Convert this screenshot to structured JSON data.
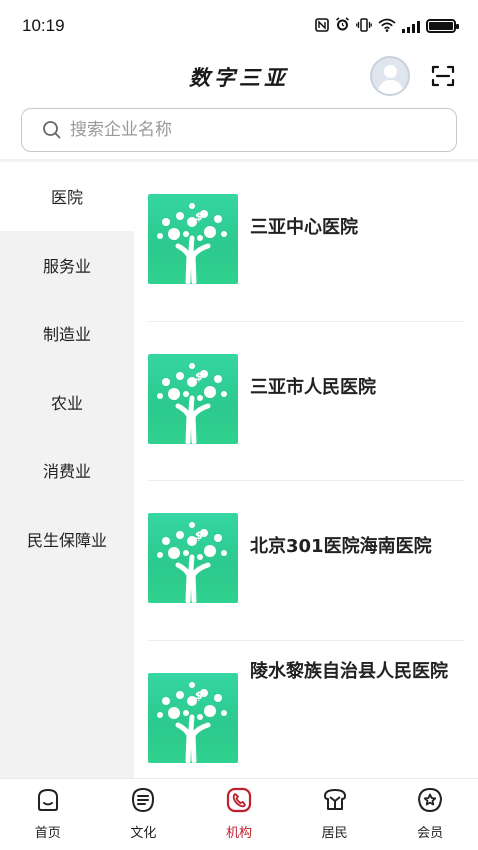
{
  "status_bar": {
    "time": "10:19",
    "icons": [
      "nfc-icon",
      "alarm-icon",
      "vibrate-icon",
      "wifi-icon",
      "signal-icon",
      "battery-icon"
    ]
  },
  "header": {
    "title": "数字三亚"
  },
  "search": {
    "placeholder": "搜索企业名称",
    "value": ""
  },
  "sidebar": {
    "items": [
      {
        "label": "医院",
        "active": true
      },
      {
        "label": "服务业",
        "active": false
      },
      {
        "label": "制造业",
        "active": false
      },
      {
        "label": "农业",
        "active": false
      },
      {
        "label": "消费业",
        "active": false
      },
      {
        "label": "民生保障业",
        "active": false
      }
    ]
  },
  "companies": [
    {
      "name": "三亚中心医院"
    },
    {
      "name": "三亚市人民医院"
    },
    {
      "name": "北京301医院海南医院"
    },
    {
      "name": "陵水黎族自治县人民医院"
    }
  ],
  "bottom_nav": {
    "items": [
      {
        "label": "首页",
        "icon": "home-icon",
        "active": false
      },
      {
        "label": "文化",
        "icon": "culture-icon",
        "active": false
      },
      {
        "label": "机构",
        "icon": "institution-icon",
        "active": true
      },
      {
        "label": "居民",
        "icon": "resident-icon",
        "active": false
      },
      {
        "label": "会员",
        "icon": "member-icon",
        "active": false
      }
    ]
  },
  "colors": {
    "accent": "#c0202e",
    "logo_green": "#2bc98e",
    "sidebar_bg": "#f2f2f2"
  }
}
